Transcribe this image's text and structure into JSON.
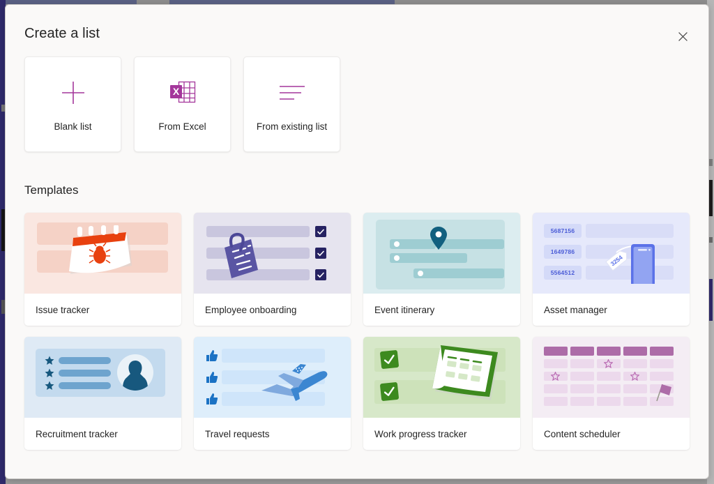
{
  "dialog": {
    "title": "Create a list",
    "close_label": "Close",
    "close_icon": "close-icon"
  },
  "options": {
    "items": [
      {
        "label": "Blank list",
        "icon": "plus-icon",
        "color": "#a4379b"
      },
      {
        "label": "From Excel",
        "icon": "excel-icon",
        "color": "#a4379b"
      },
      {
        "label": "From existing list",
        "icon": "list-lines-icon",
        "color": "#a4379b"
      }
    ]
  },
  "templates": {
    "heading": "Templates",
    "items": [
      {
        "label": "Issue tracker",
        "art": "issue-tracker-art",
        "bg": "#fae7e1",
        "accent": "#e8410f"
      },
      {
        "label": "Employee onboarding",
        "art": "employee-onboarding-art",
        "bg": "#e6e4ef",
        "accent": "#262262"
      },
      {
        "label": "Event itinerary",
        "art": "event-itinerary-art",
        "bg": "#dcedf0",
        "accent": "#11607f"
      },
      {
        "label": "Asset manager",
        "art": "asset-manager-art",
        "bg": "#e6e9fb",
        "accent": "#5b72e8",
        "asset_ids": [
          "5687156",
          "1649786",
          "5564512"
        ],
        "tag_number": "3254"
      },
      {
        "label": "Recruitment tracker",
        "art": "recruitment-tracker-art",
        "bg": "#dfeaf5",
        "accent": "#17587e"
      },
      {
        "label": "Travel requests",
        "art": "travel-requests-art",
        "bg": "#deeefb",
        "accent": "#1b72c4"
      },
      {
        "label": "Work progress tracker",
        "art": "work-progress-tracker-art",
        "bg": "#d7e8c9",
        "accent": "#3d8a1f"
      },
      {
        "label": "Content scheduler",
        "art": "content-scheduler-art",
        "bg": "#f4edf4",
        "accent": "#ad6ca8"
      }
    ]
  },
  "theme": {
    "dialog_bg": "#faf9f8",
    "card_bg": "#ffffff",
    "text": "#242424",
    "brand": "#a4379b"
  }
}
